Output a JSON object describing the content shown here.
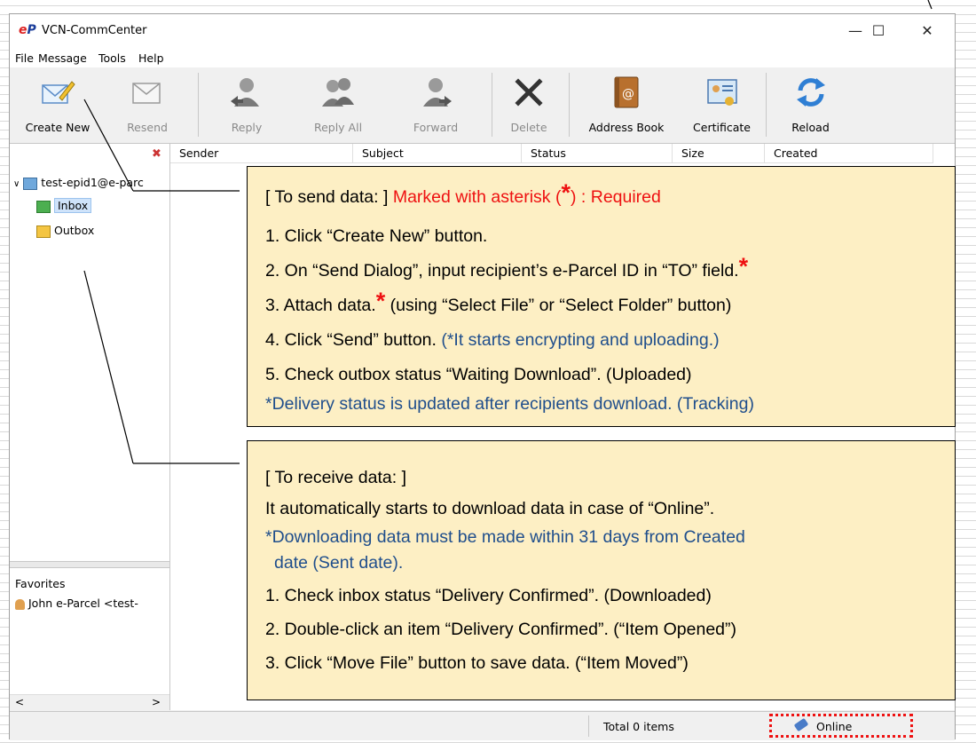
{
  "window": {
    "title": "VCN-CommCenter",
    "logo": "eP"
  },
  "window_controls": {
    "minimize": "—",
    "maximize": "☐",
    "close": "✕"
  },
  "menu": [
    "File",
    "Message",
    "Tools",
    "Help"
  ],
  "toolbar": {
    "create_new": "Create New",
    "resend": "Resend",
    "reply": "Reply",
    "reply_all": "Reply All",
    "forward": "Forward",
    "delete": "Delete",
    "address_book": "Address Book",
    "certificate": "Certificate",
    "reload": "Reload"
  },
  "tree": {
    "account": "test-epid1@e-parc",
    "inbox": "Inbox",
    "outbox": "Outbox"
  },
  "favorites": {
    "label": "Favorites",
    "contact": "John e-Parcel <test-"
  },
  "columns": [
    "Sender",
    "Subject",
    "Status",
    "Size",
    "Created"
  ],
  "status": {
    "total": "Total 0 items",
    "online": "Online"
  },
  "callout_send": {
    "heading": "[ To send data: ]",
    "required_note_pre": "Marked with asterisk (",
    "asterisk": "*",
    "required_note_post": ") : Required",
    "step1": "1. Click “Create New” button.",
    "step2": "2. On “Send Dialog”, input recipient’s e-Parcel ID in “TO” field.",
    "step3_pre": "3. Attach data.",
    "step3_post": " (using “Select File” or “Select Folder” button)",
    "step4": "4. Click “Send” button. ",
    "step4_note": "(*It starts encrypting and uploading.)",
    "step5": "5. Check outbox status “Waiting Download”. (Uploaded)",
    "note": "*Delivery status is updated after recipients download. (Tracking)"
  },
  "callout_receive": {
    "heading": "[ To receive data: ]",
    "line1": "It automatically starts to download data in case of “Online”.",
    "note_line1": "*Downloading data must be made within 31 days from Created",
    "note_line2": "date (Sent date).",
    "step1": "1. Check inbox status “Delivery Confirmed”. (Downloaded)",
    "step2": "2. Double-click an item “Delivery Confirmed”. (“Item Opened”)",
    "step3": "3. Click “Move File” button to save data. (“Item Moved”)"
  },
  "colors": {
    "callout_bg": "#fdefc4",
    "required_red": "#e11111",
    "note_blue": "#1f4e8c",
    "selection": "#cfe3fa"
  }
}
